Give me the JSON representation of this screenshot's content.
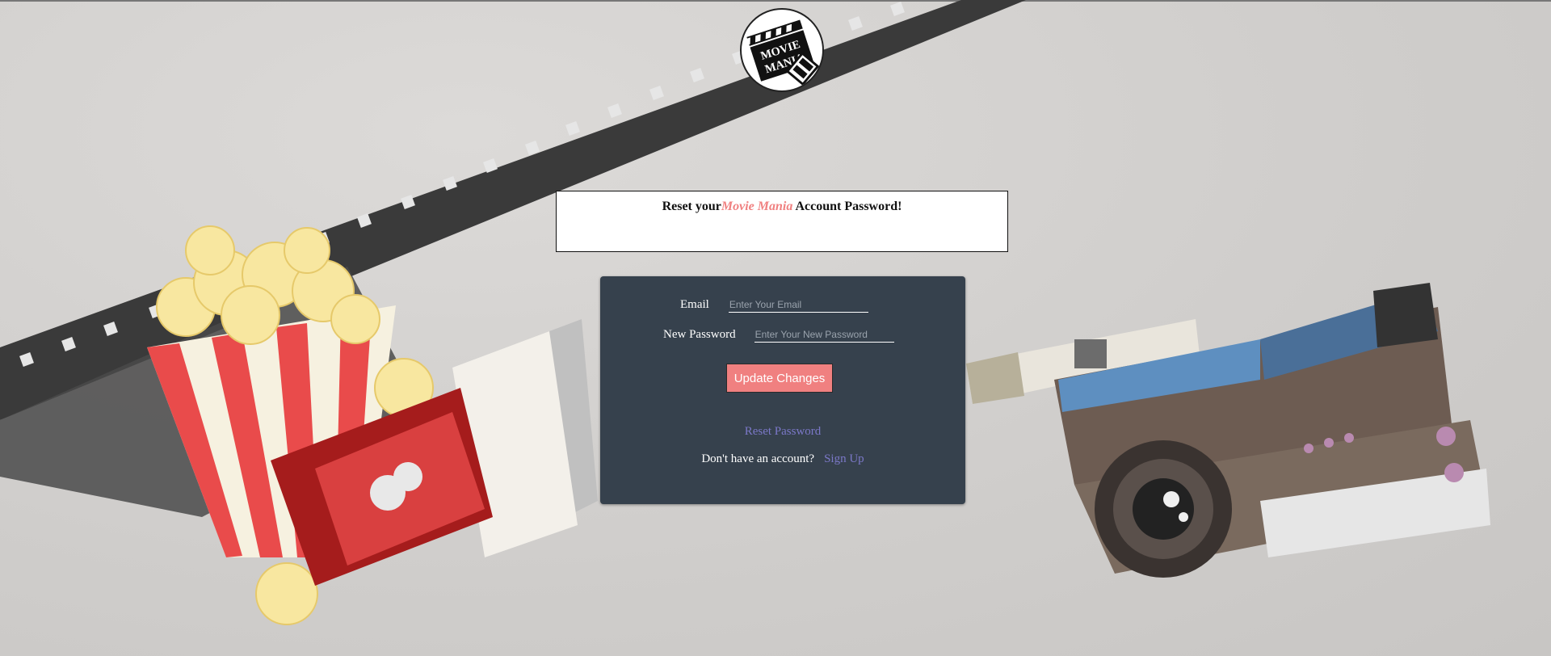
{
  "logo": {
    "text_line1": "MOVIE",
    "text_line2": "MANIA",
    "icon": "clapperboard-icon"
  },
  "title": {
    "prefix": "Reset your",
    "brand": "Movie Mania",
    "suffix": " Account Password!"
  },
  "form": {
    "email_label": "Email",
    "email_placeholder": "Enter Your Email",
    "email_value": "",
    "password_label": "New Password",
    "password_placeholder": "Enter Your New Password",
    "password_value": "",
    "submit_label": "Update Changes"
  },
  "links": {
    "reset_password": "Reset Password",
    "no_account_text": "Don't have an account?",
    "signup_label": "Sign Up"
  },
  "colors": {
    "accent": "#f08080",
    "panel": "#36414d",
    "link": "#7b78c8"
  }
}
